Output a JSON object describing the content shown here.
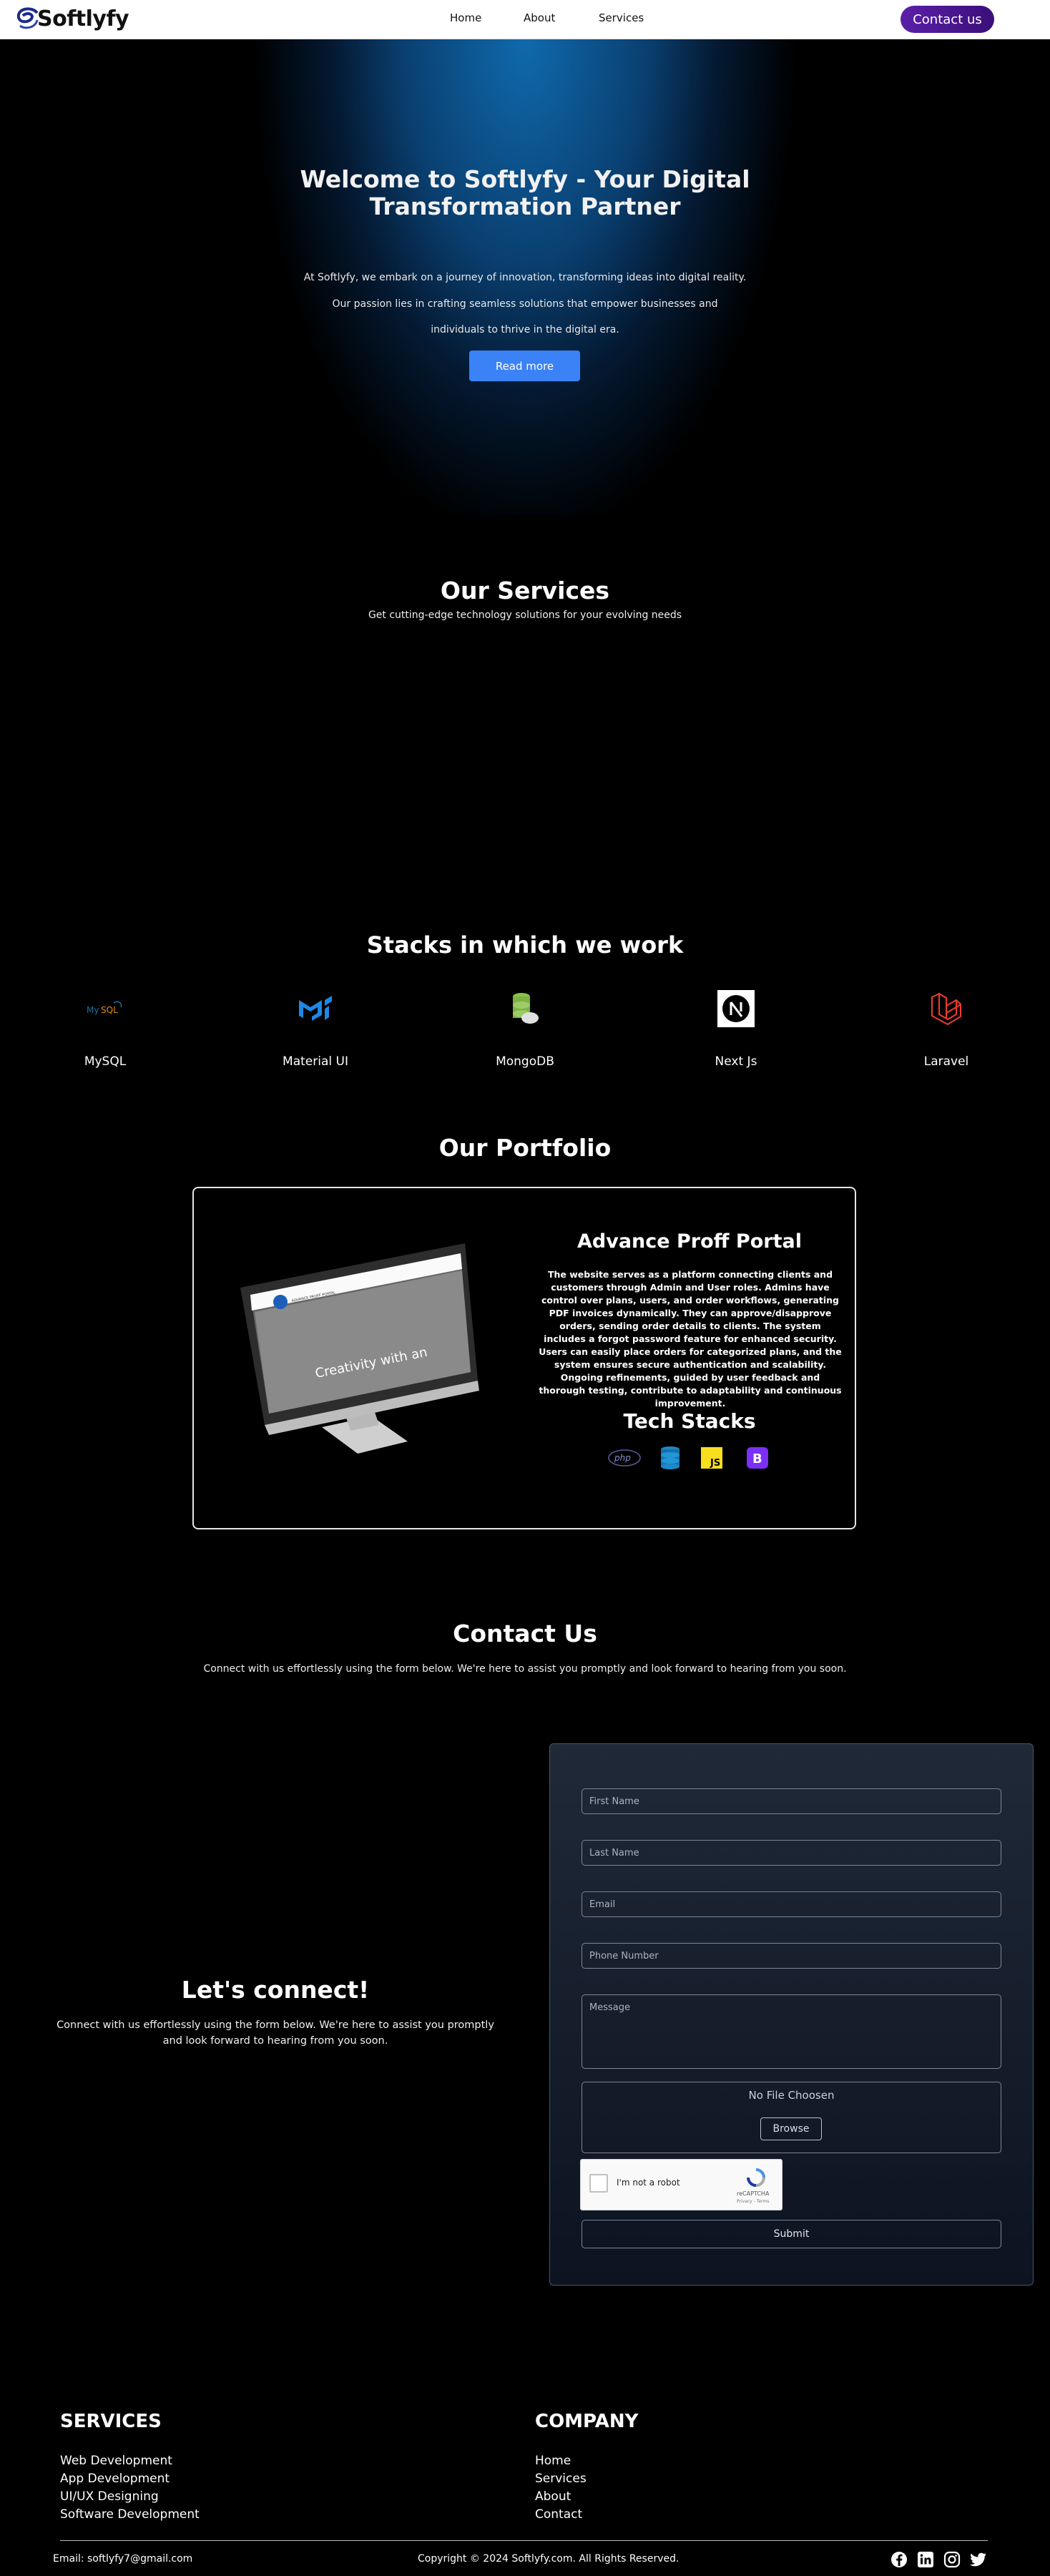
{
  "nav": {
    "logo": "Softlyfy",
    "links": [
      "Home",
      "About",
      "Services"
    ],
    "contact_button": "Contact us"
  },
  "hero": {
    "title": "Welcome to Softlyfy - Your Digital Transformation Partner",
    "lines": [
      "At Softlyfy, we embark on a journey of innovation, transforming ideas into digital reality.",
      "Our passion lies in crafting seamless solutions that empower businesses and",
      "individuals to thrive in the digital era."
    ],
    "button": "Read more"
  },
  "services": {
    "title": "Our Services",
    "subtitle": "Get cutting-edge technology solutions for your evolving needs"
  },
  "stacks": {
    "title": "Stacks in which we work",
    "items": [
      {
        "label": "MySQL",
        "icon": "mysql-icon"
      },
      {
        "label": "Material UI",
        "icon": "material-ui-icon"
      },
      {
        "label": "MongoDB",
        "icon": "mongodb-icon"
      },
      {
        "label": "Next Js",
        "icon": "nextjs-icon"
      },
      {
        "label": "Laravel",
        "icon": "laravel-icon"
      }
    ]
  },
  "portfolio": {
    "title": "Our Portfolio",
    "project_title": "Advance Proff Portal",
    "description": "The website serves as a platform connecting clients and customers through Admin and User roles. Admins have control over plans, users, and order workflows, generating PDF invoices dynamically. They can approve/disapprove orders, sending order details to clients. The system includes a forgot password feature for enhanced security. Users can easily place orders for categorized plans, and the system ensures secure authentication and scalability. Ongoing refinements, guided by user feedback and thorough testing, contribute to adaptability and continuous improvement.",
    "tech_title": "Tech Stacks",
    "mockup_text": "Creativity with an",
    "mockup_brand": "ADVANCE PROFF PORTAL",
    "tech_icons": [
      "php-icon",
      "database-icon",
      "javascript-icon",
      "bootstrap-icon"
    ]
  },
  "contact": {
    "title": "Contact Us",
    "subtitle": "Connect with us effortlessly using the form below. We're here to assist you promptly and look forward to hearing from you soon.",
    "lets_connect": "Let's connect!",
    "lets_connect_text": "Connect with us effortlessly using the form below. We're here to assist you promptly and look forward to hearing from you soon.",
    "form": {
      "first_name": "First Name",
      "last_name": "Last Name",
      "email": "Email",
      "phone": "Phone Number",
      "message": "Message",
      "no_file": "No File Choosen",
      "browse": "Browse",
      "captcha_label": "I'm not a robot",
      "captcha_brand": "reCAPTCHA",
      "captcha_terms": "Privacy - Terms",
      "submit": "Submit"
    }
  },
  "footer": {
    "services_title": "SERVICES",
    "services": [
      "Web Development",
      "App Development",
      "UI/UX Designing",
      "Software Development"
    ],
    "company_title": "COMPANY",
    "company": [
      "Home",
      "Services",
      "About",
      "Contact"
    ],
    "email": "Email: softlyfy7@gmail.com",
    "copyright": "Copyright © 2024 Softlyfy.com. All Rights Reserved."
  },
  "colors": {
    "accent_blue": "#3b82f6",
    "contact_purple": "#5b1fa8",
    "hero_blue": "#0f6aad"
  }
}
